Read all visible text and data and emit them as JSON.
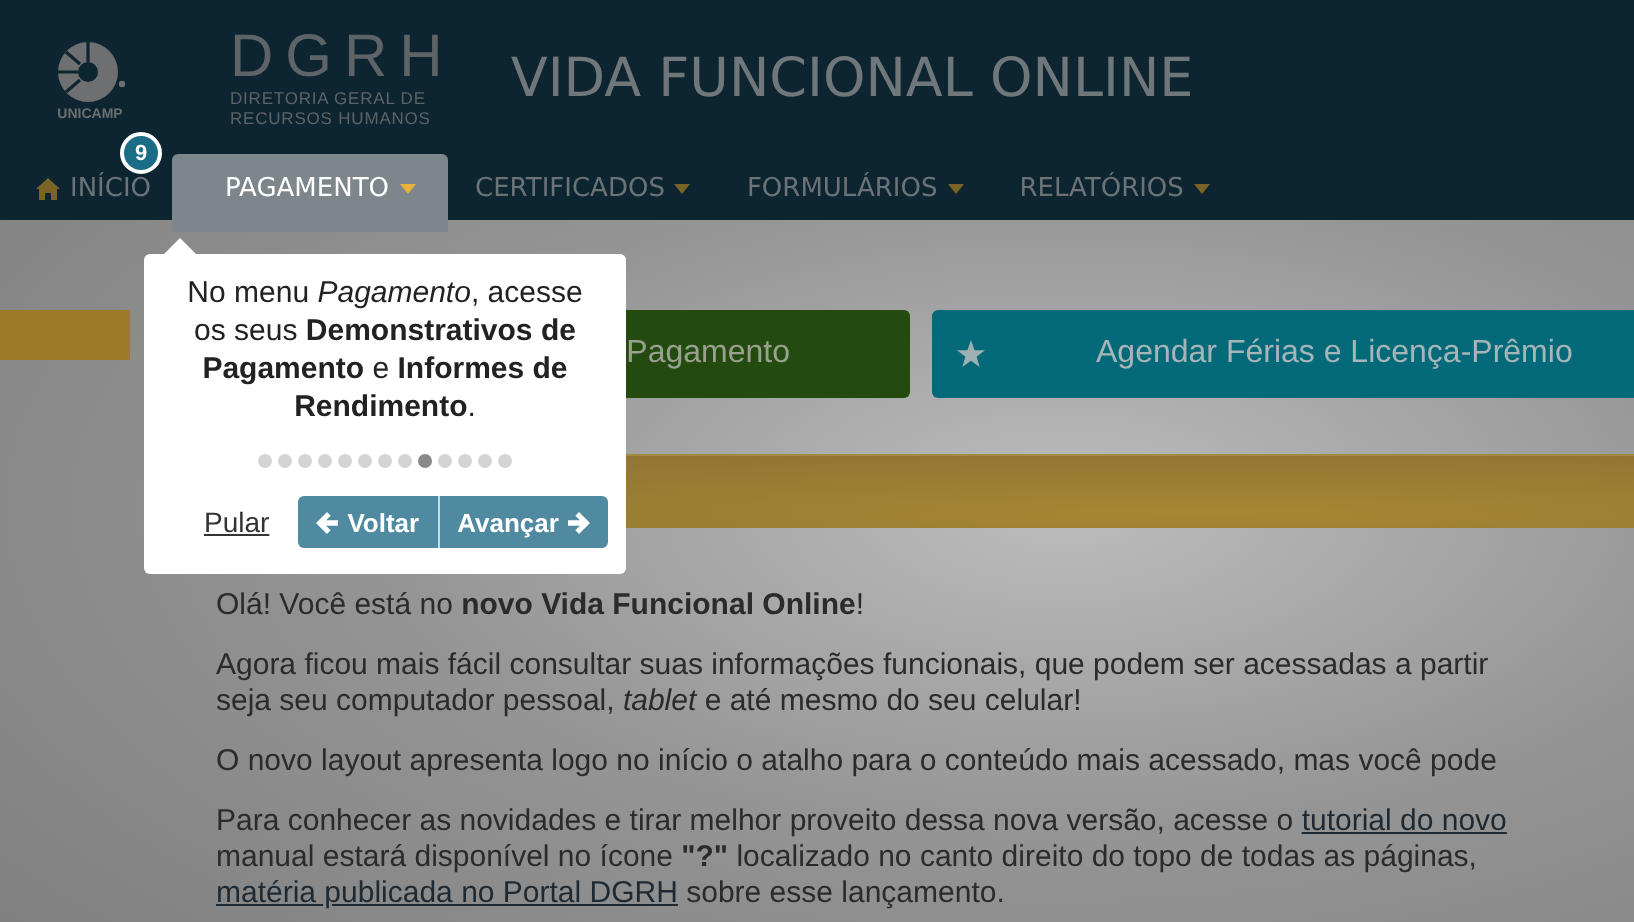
{
  "header": {
    "logo_caption": "UNICAMP",
    "org_acronym": "DGRH",
    "org_name_lines": [
      "DIRETORIA GERAL DE",
      "RECURSOS HUMANOS"
    ],
    "title": "VIDA FUNCIONAL ONLINE"
  },
  "nav": [
    {
      "label": "INÍCIO",
      "kind": "home",
      "selected": false
    },
    {
      "label": "PAGAMENTO",
      "kind": "menu",
      "selected": true
    },
    {
      "label": "CERTIFICADOS",
      "kind": "menu",
      "selected": false
    },
    {
      "label": "FORMULÁRIOS",
      "kind": "menu",
      "selected": false
    },
    {
      "label": "RELATÓRIOS",
      "kind": "menu",
      "selected": false
    }
  ],
  "shortcuts": [
    {
      "label": "Pagamento",
      "kind": "green"
    },
    {
      "label": "Agendar Férias e Licença-Prêmio",
      "kind": "teal"
    }
  ],
  "paragraphs": [
    [
      [
        {
          "kind": "plain",
          "text": "Olá! Você está no "
        },
        {
          "kind": "bold",
          "text": "novo Vida Funcional Online"
        },
        {
          "kind": "plain",
          "text": "!"
        }
      ]
    ],
    [
      [
        {
          "kind": "plain",
          "text": "Agora ficou mais fácil consultar suas informações funcionais, que podem ser acessadas a partir"
        }
      ],
      [
        {
          "kind": "plain",
          "text": "seja seu computador pessoal, "
        },
        {
          "kind": "italic",
          "text": "tablet"
        },
        {
          "kind": "plain",
          "text": " e até mesmo do seu celular!"
        }
      ]
    ],
    [
      [
        {
          "kind": "plain",
          "text": "O novo layout apresenta logo no início o atalho para o conteúdo mais acessado, mas você pode"
        }
      ]
    ],
    [
      [
        {
          "kind": "plain",
          "text": "Para conhecer as novidades e tirar melhor proveito dessa nova versão, acesse o "
        },
        {
          "kind": "link",
          "text": "tutorial do novo"
        }
      ],
      [
        {
          "kind": "plain",
          "text": "manual estará disponível no ícone "
        },
        {
          "kind": "bold",
          "text": "\"?\""
        },
        {
          "kind": "plain",
          "text": " localizado no canto direito do topo de todas as páginas,"
        }
      ],
      [
        {
          "kind": "link",
          "text": "matéria publicada no Portal DGRH"
        },
        {
          "kind": "plain",
          "text": " sobre esse lançamento."
        }
      ]
    ]
  ],
  "tour": {
    "step": "9",
    "text": "No menu *Pagamento*, acesse os seus **Demonstrativos de Pagamento** e **Informes de Rendimento**.",
    "dots": [
      {
        "selected": false
      },
      {
        "selected": false
      },
      {
        "selected": false
      },
      {
        "selected": false
      },
      {
        "selected": false
      },
      {
        "selected": false
      },
      {
        "selected": false
      },
      {
        "selected": false
      },
      {
        "selected": true
      },
      {
        "selected": false
      },
      {
        "selected": false
      },
      {
        "selected": false
      },
      {
        "selected": false
      }
    ],
    "skip": "Pular",
    "back": "Voltar",
    "next": "Avançar"
  }
}
